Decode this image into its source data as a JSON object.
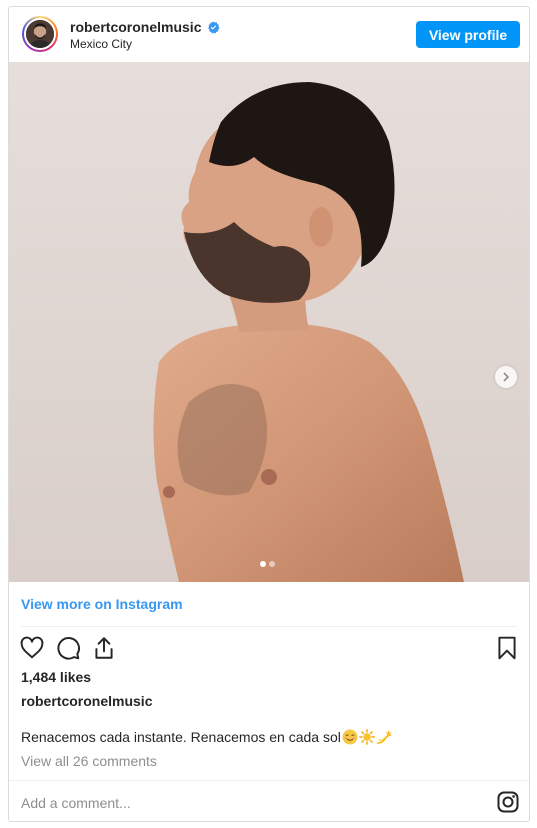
{
  "post": {
    "username": "robertcoronelmusic",
    "location": "Mexico City",
    "view_profile_label": "View profile",
    "view_more_label": "View more on Instagram",
    "likes": "1,484 likes",
    "caption_author": "robertcoronelmusic",
    "caption_text": "Renacemos cada instante. Renacemos en cada sol",
    "comments_link": "View all 26 comments",
    "comment_placeholder": "Add a comment...",
    "carousel": {
      "total_slides": 2,
      "active_slide": 1
    }
  },
  "icons": {
    "verified": "verified-badge-icon",
    "like": "heart-icon",
    "comment": "comment-icon",
    "share": "share-icon",
    "save": "bookmark-icon",
    "next": "chevron-right-icon",
    "logo": "instagram-logo-icon"
  },
  "colors": {
    "accent": "#0095f6",
    "link": "#3897f0",
    "text": "#262626",
    "muted": "#8e8e8e",
    "border": "#dbdbdb"
  }
}
